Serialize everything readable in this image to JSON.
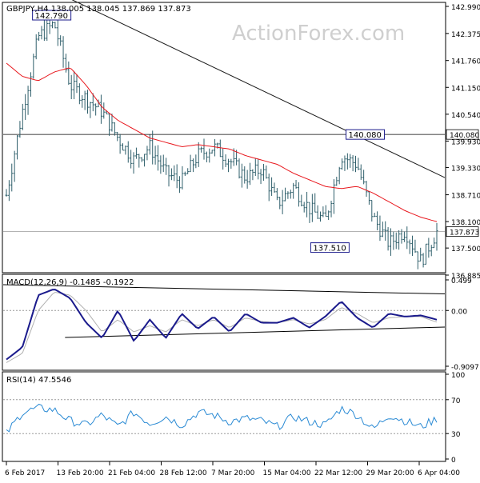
{
  "watermark": "ActionForex.com",
  "price_panel": {
    "header": "GBPJPY,H4  138.005 138.045 137.869 137.873",
    "y_ticks": [
      "142.990",
      "142.375",
      "141.760",
      "141.150",
      "140.540",
      "139.930",
      "139.330",
      "138.710",
      "138.100",
      "137.500",
      "136.885"
    ],
    "last_price_label": "137.873",
    "resistance_label": "140.080",
    "annotations": [
      "142.790",
      "140.080",
      "137.510"
    ]
  },
  "macd_panel": {
    "header": "MACD(12,26,9) -0.1485 -0.1922",
    "y_ticks": [
      "0.499",
      "0.00",
      "-0.9097"
    ]
  },
  "rsi_panel": {
    "header": "RSI(14) 47.5546",
    "y_ticks": [
      "100",
      "70",
      "30",
      "0"
    ]
  },
  "x_ticks": [
    "6 Feb 2017",
    "13 Feb 20:00",
    "21 Feb 04:00",
    "28 Feb 12:00",
    "7 Mar 20:00",
    "15 Mar 04:00",
    "22 Mar 12:00",
    "29 Mar 20:00",
    "6 Apr 04:00"
  ],
  "colors": {
    "candles": "#2f5f6b",
    "ma": "#e8161c",
    "macd": "#1a1a8c",
    "signal": "#b0b0b0",
    "rsi": "#2a8ad4",
    "trendline": "#1a1a1a"
  },
  "chart_data": [
    {
      "type": "line",
      "title": "GBPJPY,H4",
      "description": "Candlestick price chart with 4-hour bars, red moving average, descending trendline from 142.790 high, horizontal level at 140.080",
      "ylim": [
        136.885,
        142.99
      ],
      "x_categories": [
        "6 Feb 2017",
        "13 Feb 20:00",
        "21 Feb 04:00",
        "28 Feb 12:00",
        "7 Mar 20:00",
        "15 Mar 04:00",
        "22 Mar 12:00",
        "29 Mar 20:00",
        "6 Apr 04:00"
      ],
      "series": [
        {
          "name": "Close",
          "values": [
            138.7,
            140.6,
            142.3,
            142.6,
            141.2,
            140.9,
            140.6,
            140.0,
            139.5,
            139.8,
            139.2,
            139.0,
            139.6,
            139.8,
            139.5,
            139.1,
            139.3,
            138.5,
            138.9,
            138.4,
            138.1,
            139.6,
            139.4,
            138.2,
            137.6,
            137.9,
            137.2,
            137.87
          ]
        },
        {
          "name": "MA",
          "values": [
            141.7,
            141.4,
            141.3,
            141.5,
            141.6,
            141.2,
            140.7,
            140.4,
            140.2,
            140.0,
            139.9,
            139.8,
            139.85,
            139.8,
            139.75,
            139.6,
            139.5,
            139.4,
            139.2,
            139.05,
            138.9,
            138.85,
            138.9,
            138.75,
            138.55,
            138.35,
            138.2,
            138.1
          ]
        }
      ],
      "annotations": [
        {
          "text": "142.790",
          "value": 142.79
        },
        {
          "text": "140.080",
          "value": 140.08
        },
        {
          "text": "137.510",
          "value": 137.51
        }
      ],
      "horizontal_lines": [
        140.08,
        137.873
      ],
      "trendline": [
        [
          0.06,
          143.6
        ],
        [
          1.0,
          139.1
        ]
      ]
    },
    {
      "type": "line",
      "title": "MACD(12,26,9) -0.1485 -0.1922",
      "ylim": [
        -0.9097,
        0.499
      ],
      "series": [
        {
          "name": "MACD",
          "values": [
            -0.8,
            -0.6,
            0.25,
            0.35,
            0.2,
            -0.2,
            -0.45,
            0.0,
            -0.5,
            -0.15,
            -0.45,
            -0.05,
            -0.3,
            -0.1,
            -0.35,
            -0.05,
            -0.2,
            -0.2,
            -0.12,
            -0.28,
            -0.1,
            0.15,
            -0.12,
            -0.28,
            -0.05,
            -0.1,
            -0.08,
            -0.15
          ]
        },
        {
          "name": "Signal",
          "values": [
            -0.85,
            -0.7,
            0.0,
            0.3,
            0.25,
            0.0,
            -0.35,
            -0.15,
            -0.35,
            -0.25,
            -0.35,
            -0.15,
            -0.25,
            -0.15,
            -0.28,
            -0.12,
            -0.18,
            -0.2,
            -0.15,
            -0.22,
            -0.15,
            0.05,
            -0.05,
            -0.2,
            -0.12,
            -0.1,
            -0.1,
            -0.19
          ]
        }
      ],
      "trendlines": [
        [
          [
            0.0,
            0.42
          ],
          [
            1.0,
            0.27
          ]
        ],
        [
          [
            0.14,
            -0.44
          ],
          [
            1.0,
            -0.27
          ]
        ]
      ]
    },
    {
      "type": "line",
      "title": "RSI(14) 47.5546",
      "ylim": [
        0,
        100
      ],
      "levels": [
        30,
        70
      ],
      "series": [
        {
          "name": "RSI",
          "values": [
            30,
            55,
            60,
            58,
            45,
            40,
            52,
            38,
            55,
            42,
            50,
            40,
            55,
            52,
            44,
            48,
            45,
            38,
            50,
            44,
            40,
            60,
            52,
            35,
            52,
            45,
            38,
            47.55
          ]
        }
      ]
    }
  ]
}
